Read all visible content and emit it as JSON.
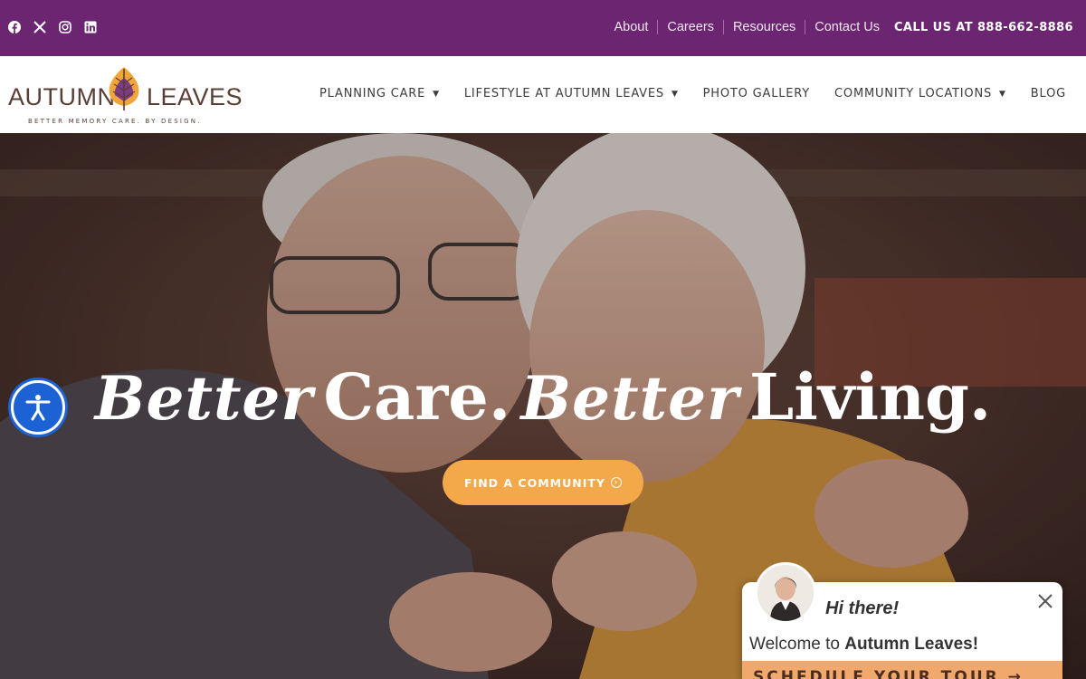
{
  "topbar": {
    "social": [
      {
        "icon": "facebook-icon"
      },
      {
        "icon": "x-twitter-icon"
      },
      {
        "icon": "instagram-icon"
      },
      {
        "icon": "linkedin-icon"
      }
    ],
    "links": [
      "About",
      "Careers",
      "Resources",
      "Contact Us"
    ],
    "call": "CALL US AT 888-662-8886",
    "bg_color": "#6b2571"
  },
  "header": {
    "logo": {
      "word_left": "AUTUMN",
      "word_right": "LEAVES",
      "tagline": "BETTER MEMORY CARE. BY DESIGN."
    },
    "nav": [
      {
        "label": "PLANNING CARE",
        "dropdown": true
      },
      {
        "label": "LIFESTYLE AT AUTUMN LEAVES",
        "dropdown": true
      },
      {
        "label": "PHOTO GALLERY",
        "dropdown": false
      },
      {
        "label": "COMMUNITY LOCATIONS",
        "dropdown": true
      },
      {
        "label": "BLOG",
        "dropdown": false
      }
    ]
  },
  "hero": {
    "headline": {
      "script1": "Better",
      "serif1": "Care.",
      "script2": "Better",
      "serif2": "Living."
    },
    "cta": "FIND A COMMUNITY",
    "cta_color": "#f3a84a"
  },
  "accessibility": {
    "icon": "accessibility-icon",
    "color": "#1c62d4"
  },
  "chat": {
    "greeting": "Hi there!",
    "welcome_prefix": "Welcome to ",
    "welcome_brand": "Autumn Leaves!",
    "schedule": "SCHEDULE YOUR TOUR →"
  }
}
